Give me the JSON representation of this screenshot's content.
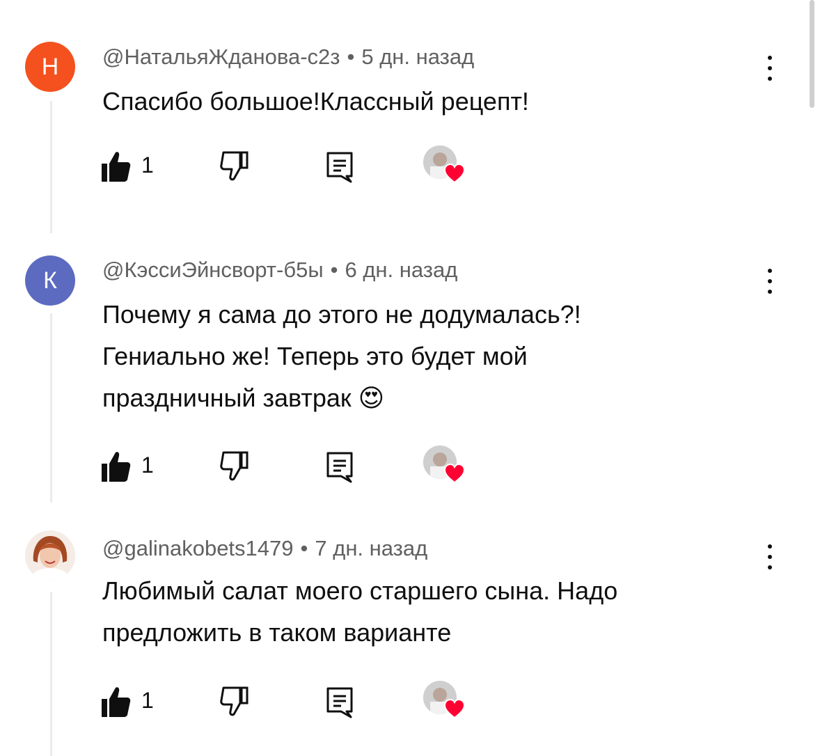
{
  "comments": [
    {
      "avatar_letter": "Н",
      "avatar_color": "#f4511e",
      "author": "@НатальяЖданова-с2з",
      "time": "5 дн. назад",
      "text_lines": [
        "Спасибо большое!Классный рецепт!"
      ],
      "likes": "1"
    },
    {
      "avatar_letter": "К",
      "avatar_color": "#5c6bc0",
      "author": "@КэссиЭйнсворт-б5ы",
      "time": "6 дн. назад",
      "text_lines": [
        "Почему я сама до этого не додумалась?!",
        "Гениально же! Теперь это будет мой",
        "праздничный завтрак 😍"
      ],
      "likes": "1"
    },
    {
      "avatar_letter": "",
      "avatar_color": "#f3e7df",
      "author": "@galinakobets1479",
      "time": "7 дн. назад",
      "text_lines": [
        "Любимый салат моего старшего сына. Надо",
        "предложить в таком варианте"
      ],
      "likes": "1"
    }
  ],
  "separator": "•",
  "icons": {
    "like": "thumbs-up-filled-icon",
    "dislike": "thumbs-down-icon",
    "reply": "reply-icon",
    "creator_heart": "creator-heart-icon",
    "menu": "more-vert-icon"
  },
  "colors": {
    "meta_gray": "#606060",
    "heart_red": "#ff0033"
  }
}
